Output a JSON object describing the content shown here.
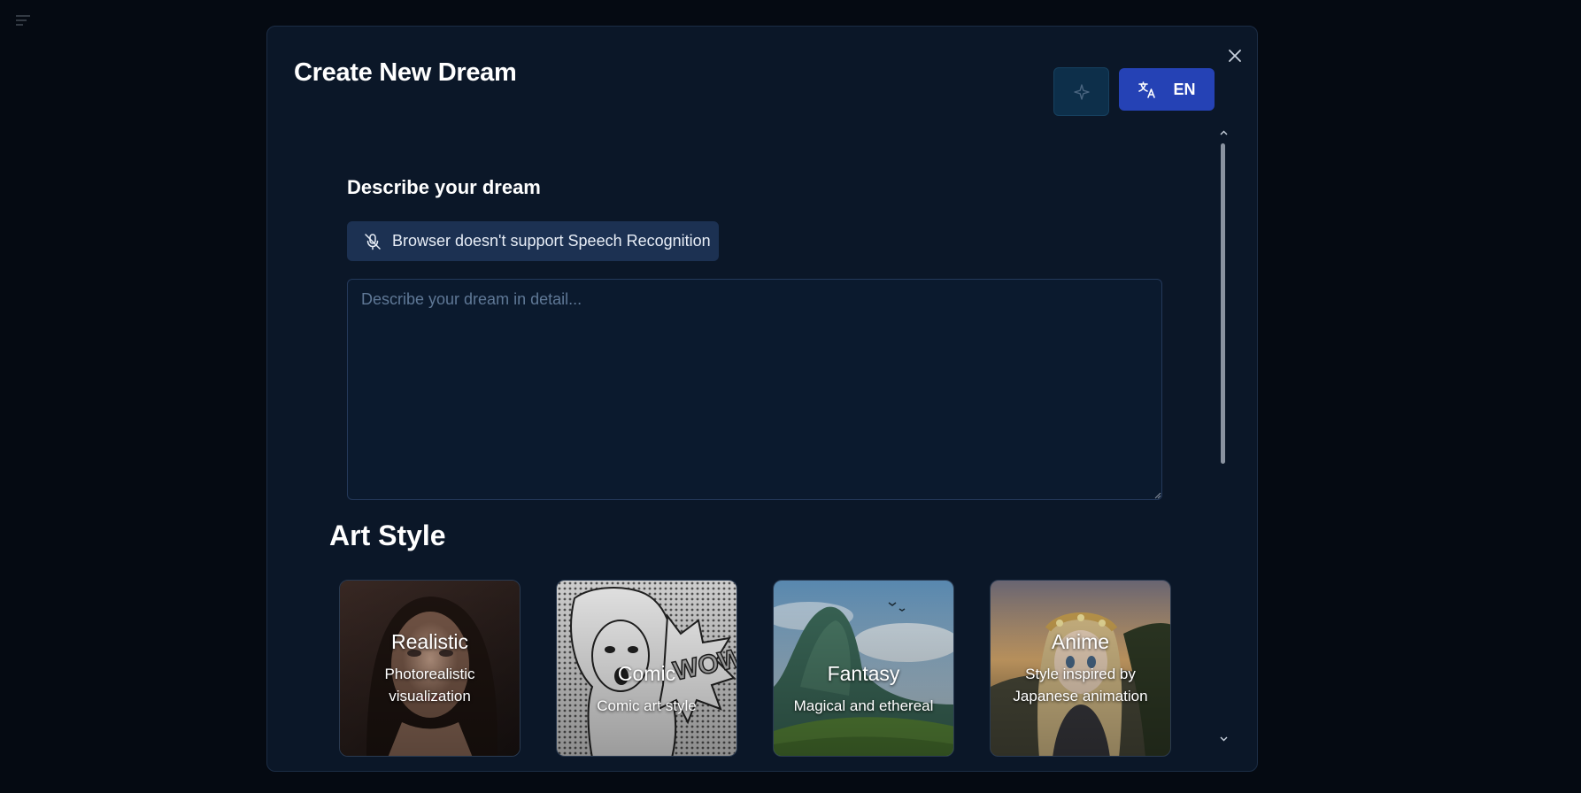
{
  "modal": {
    "title": "Create New Dream",
    "language_label": "EN"
  },
  "dream": {
    "section_label": "Describe your dream",
    "speech_label": "Browser doesn't support Speech Recognition",
    "placeholder": "Describe your dream in detail..."
  },
  "art_style": {
    "title": "Art Style",
    "cards": [
      {
        "name": "Realistic",
        "desc_line1": "Photorealistic",
        "desc_line2": "visualization"
      },
      {
        "name": "Comic",
        "desc_line1": "Comic art style",
        "desc_line2": ""
      },
      {
        "name": "Fantasy",
        "desc_line1": "Magical and ethereal",
        "desc_line2": ""
      },
      {
        "name": "Anime",
        "desc_line1": "Style inspired by",
        "desc_line2": "Japanese animation"
      }
    ]
  },
  "icons": {
    "menu": "menu-icon",
    "close": "close-icon",
    "sparkle": "sparkle-icon",
    "translate": "translate-icon",
    "mic_off": "mic-off-icon"
  },
  "colors": {
    "background": "#050a12",
    "modal": "#0b1728",
    "accent": "#2542b5",
    "speech_button": "#1c3152"
  }
}
